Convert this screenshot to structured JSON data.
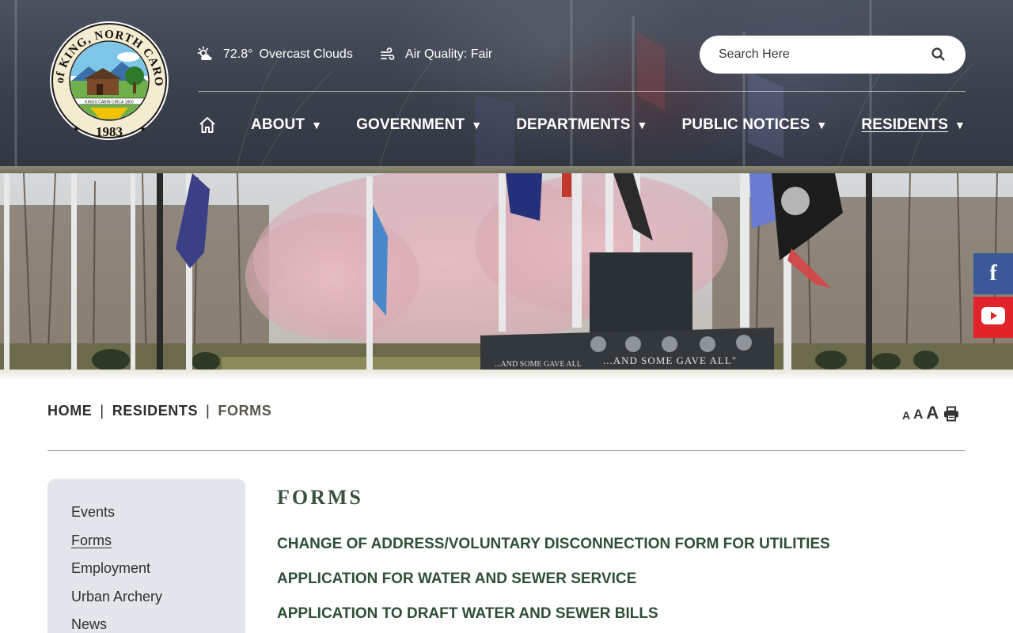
{
  "header": {
    "logo": {
      "arc_text_top": "CITY of KING, NORTH CAROLINA",
      "year": "1983",
      "banner_text": "KINGS CABIN CIRCA 1850"
    },
    "weather": {
      "temperature": "72.8°",
      "condition": "Overcast Clouds",
      "icon": "partly-cloudy-sun-icon"
    },
    "air_quality": {
      "label": "Air Quality: Fair",
      "icon": "wind-icon"
    },
    "search": {
      "placeholder": "Search Here",
      "icon": "search-icon"
    },
    "nav": {
      "home_icon": "home-icon",
      "items": [
        {
          "label": "ABOUT",
          "caret": "▼"
        },
        {
          "label": "GOVERNMENT",
          "caret": "▼"
        },
        {
          "label": "DEPARTMENTS",
          "caret": "▼"
        },
        {
          "label": "PUBLIC NOTICES",
          "caret": "▼"
        },
        {
          "label": "RESIDENTS",
          "caret": "▼",
          "active": true
        }
      ]
    }
  },
  "hero": {
    "memorial_text_left": "...AND SOME GAVE ALL",
    "memorial_text_right": "...AND SOME GAVE ALL\""
  },
  "social": {
    "facebook_icon": "facebook-icon",
    "facebook_glyph": "f",
    "youtube_icon": "youtube-icon",
    "facebook_color": "#3b5998",
    "youtube_color": "#e0242a"
  },
  "breadcrumb": {
    "items": [
      "HOME",
      "RESIDENTS",
      "FORMS"
    ],
    "separator": "|"
  },
  "font_tools": {
    "small": "A",
    "medium": "A",
    "large": "A",
    "print_icon": "print-icon"
  },
  "sidebar": {
    "items": [
      {
        "label": "Events"
      },
      {
        "label": "Forms",
        "active": true
      },
      {
        "label": "Employment"
      },
      {
        "label": "Urban Archery"
      },
      {
        "label": "News"
      }
    ]
  },
  "main": {
    "title": "FORMS",
    "forms": [
      "CHANGE OF ADDRESS/VOLUNTARY DISCONNECTION FORM FOR UTILITIES",
      "APPLICATION FOR WATER AND SEWER SERVICE",
      "APPLICATION TO DRAFT WATER AND SEWER BILLS"
    ]
  },
  "colors": {
    "header_bg": "#3d4350",
    "accent_band": "#8a8572",
    "title_green": "#38523c",
    "link_green": "#2e4f36",
    "sidebar_bg": "#e3e6ea"
  }
}
